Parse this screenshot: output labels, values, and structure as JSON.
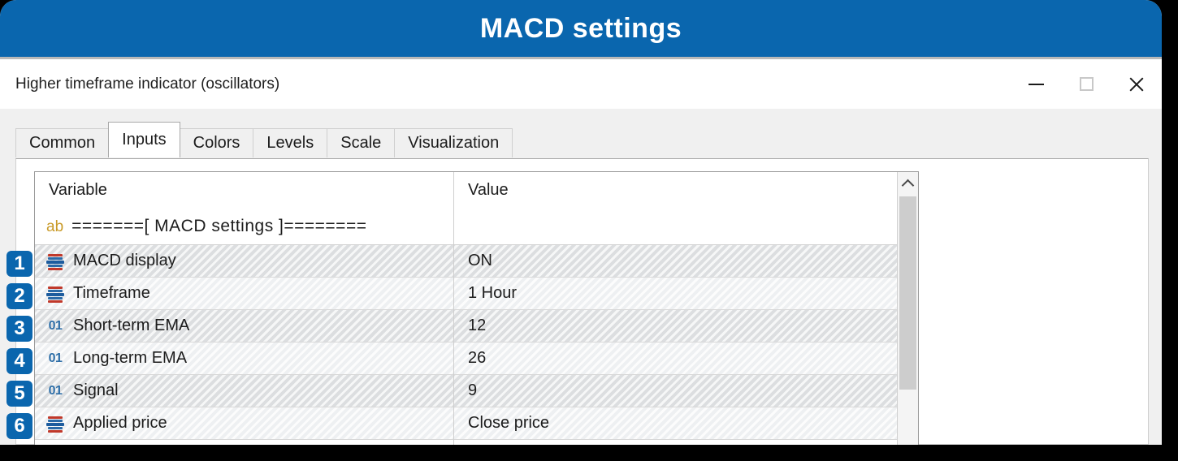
{
  "banner": {
    "title": "MACD settings"
  },
  "titlebar": {
    "text": "Higher timeframe indicator (oscillators)",
    "minimize_label": "Minimize",
    "maximize_label": "Maximize",
    "close_label": "Close"
  },
  "tabs": [
    {
      "label": "Common",
      "active": false
    },
    {
      "label": "Inputs",
      "active": true
    },
    {
      "label": "Colors",
      "active": false
    },
    {
      "label": "Levels",
      "active": false
    },
    {
      "label": "Scale",
      "active": false
    },
    {
      "label": "Visualization",
      "active": false
    }
  ],
  "table": {
    "headers": {
      "variable": "Variable",
      "value": "Value"
    },
    "group_row": {
      "icon": "ab-string-icon",
      "icon_text": "ab",
      "label": "=======[ MACD settings ]========"
    },
    "rows": [
      {
        "badge": "1",
        "icon": "enum-icon",
        "variable": "MACD display",
        "value": "ON"
      },
      {
        "badge": "2",
        "icon": "enum-icon",
        "variable": "Timeframe",
        "value": "1 Hour"
      },
      {
        "badge": "3",
        "icon": "integer-icon",
        "icon_text": "01",
        "variable": "Short-term EMA",
        "value": "12"
      },
      {
        "badge": "4",
        "icon": "integer-icon",
        "icon_text": "01",
        "variable": "Long-term EMA",
        "value": "26"
      },
      {
        "badge": "5",
        "icon": "integer-icon",
        "icon_text": "01",
        "variable": "Signal",
        "value": "9"
      },
      {
        "badge": "6",
        "icon": "enum-icon",
        "variable": "Applied price",
        "value": "Close price"
      }
    ]
  },
  "scrollbar": {
    "up_arrow": "chevron-up-icon"
  },
  "colors": {
    "accent": "#0a66ae",
    "badge": "#0a66ae",
    "string_icon": "#c99a28",
    "integer_icon": "#2f6fa8",
    "enum_icon_red": "#c0392b",
    "enum_icon_blue": "#1d5c9e",
    "panel_bg": "#f0f0f0",
    "text": "#1c1c1c"
  }
}
